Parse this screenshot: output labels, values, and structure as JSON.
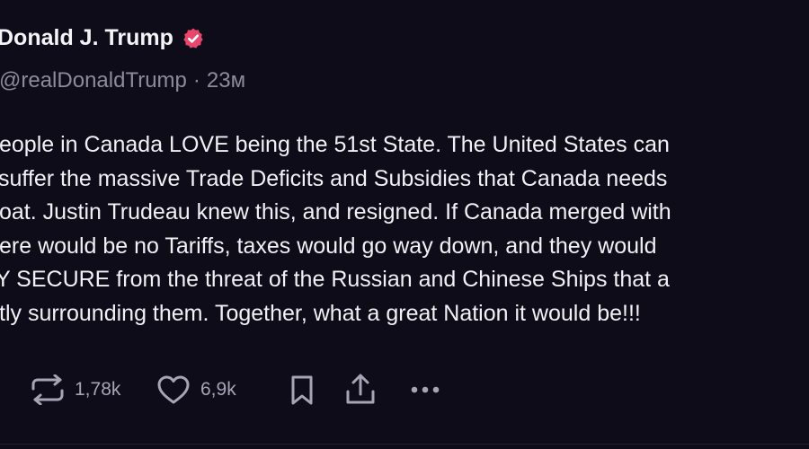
{
  "post": {
    "author": {
      "display_name": "Donald J. Trump",
      "verified_icon": "verified-badge-icon",
      "handle": "@realDonaldTrump",
      "separator": "·",
      "time_ago": "23м"
    },
    "text_lines": [
      "eople in Canada LOVE being the 51st State. The United States can",
      "suffer the massive Trade Deficits and Subsidies that Canada needs",
      "oat. Justin Trudeau knew this, and resigned. If Canada merged with",
      "ere would be no Tariffs, taxes would go way down, and they would",
      "Y SECURE from the threat of the Russian and Chinese Ships that a",
      "tly surrounding them. Together, what a great Nation it would be!!!"
    ],
    "actions": {
      "repost": {
        "icon": "repost-icon",
        "count": "1,78k"
      },
      "like": {
        "icon": "heart-icon",
        "count": "6,9k"
      },
      "bookmark": {
        "icon": "bookmark-icon"
      },
      "share": {
        "icon": "share-icon"
      },
      "more": {
        "icon": "more-icon"
      }
    }
  },
  "colors": {
    "background": "#0e0c19",
    "text": "#f1f1f5",
    "muted": "#8d8a9c",
    "action": "#a7a4b5",
    "verified": "#e8466c"
  }
}
